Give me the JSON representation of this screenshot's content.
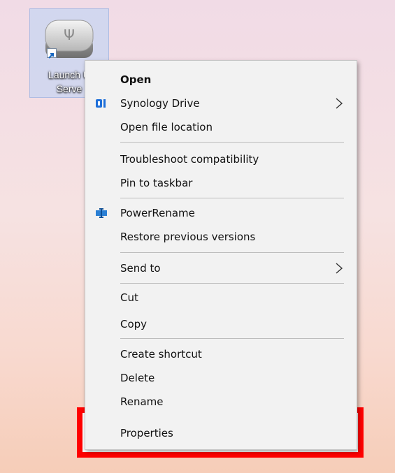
{
  "desktop": {
    "shortcut": {
      "label_line1": "Launch U",
      "label_line2": "Serve",
      "icon": "usb-server-icon"
    }
  },
  "context_menu": {
    "items": [
      {
        "label": "Open",
        "bold": true
      },
      {
        "label": "Synology Drive",
        "icon": "synology-drive-icon",
        "submenu": true
      },
      {
        "label": "Open file location"
      },
      {
        "label": "Troubleshoot compatibility"
      },
      {
        "label": "Pin to taskbar"
      },
      {
        "label": "PowerRename",
        "icon": "powerrename-icon"
      },
      {
        "label": "Restore previous versions"
      },
      {
        "label": "Send to",
        "submenu": true
      },
      {
        "label": "Cut"
      },
      {
        "label": "Copy"
      },
      {
        "label": "Create shortcut"
      },
      {
        "label": "Delete"
      },
      {
        "label": "Rename"
      },
      {
        "label": "Properties"
      }
    ]
  },
  "highlight": {
    "target": "Properties",
    "color": "#ff0000"
  },
  "colors": {
    "synology_blue": "#1e6fd9",
    "powerrename_blue": "#2a7fd4"
  }
}
